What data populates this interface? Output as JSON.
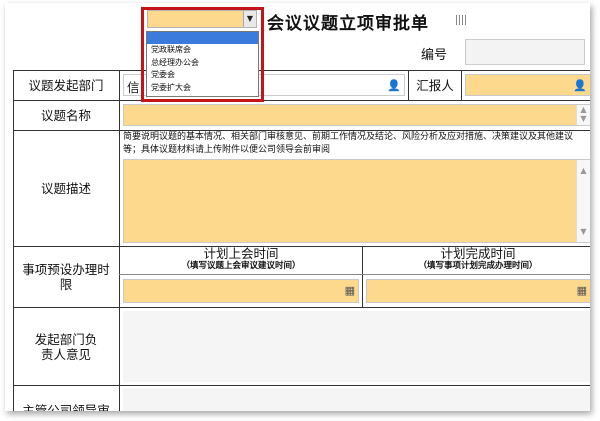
{
  "form": {
    "title": "会议议题立项审批单",
    "number_label": "编号"
  },
  "topic_type_select": {
    "value": "",
    "options": [
      "",
      "党政联席会",
      "总经理办公会",
      "党委会",
      "党委扩大会"
    ]
  },
  "rows": {
    "dept_label": "议题发起部门",
    "dept_value_partial": "信",
    "reporter_label": "汇报人",
    "topic_name_label": "议题名称",
    "topic_desc_label": "议题描述",
    "topic_desc_hint": "简要说明议题的基本情况、相关部门审核意见、前期工作情况及结论、风险分析及应对措施、决策建议及其他建议等；具体议题材料请上传附件以便公司领导会前审阅",
    "timeline_label": "事项预设办理时限",
    "plan_meeting_time": "计划上会时间",
    "plan_meeting_hint": "（填写议题上会审议建议时间）",
    "plan_complete_time": "计划完成时间",
    "plan_complete_hint": "（填写事项计划完成办理时间）",
    "dept_head_opinion_label": "发起部门负责人意见",
    "leader_review_label_partial": "主管公司领导审"
  },
  "colors": {
    "input_fill": "#fcd98c",
    "highlight_border": "#c4141a",
    "dropdown_selected": "#3a7bdc"
  },
  "icons": [
    "dropdown-arrow-icon",
    "person-picker-icon",
    "calendar-icon",
    "scroll-up-icon",
    "scroll-down-icon"
  ]
}
